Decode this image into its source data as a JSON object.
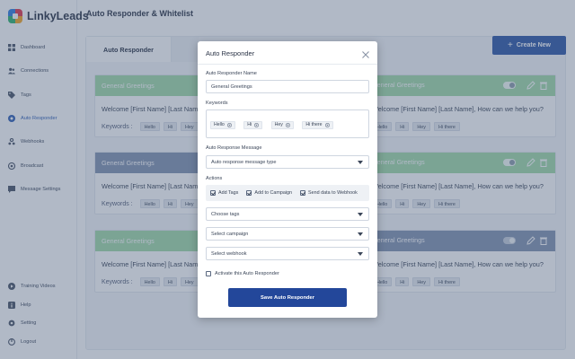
{
  "app": {
    "name": "LinkyLeads"
  },
  "sidebar": {
    "items": [
      {
        "label": "Dashboard",
        "icon": "dashboard-icon"
      },
      {
        "label": "Connections",
        "icon": "users-icon"
      },
      {
        "label": "Tags",
        "icon": "tag-icon"
      },
      {
        "label": "Auto Responder",
        "icon": "responder-icon",
        "active": true
      },
      {
        "label": "Webhooks",
        "icon": "webhook-icon"
      },
      {
        "label": "Broadcast",
        "icon": "broadcast-icon"
      },
      {
        "label": "Message Settings",
        "icon": "message-icon"
      }
    ],
    "bottom_items": [
      {
        "label": "Training Videos",
        "icon": "play-icon"
      },
      {
        "label": "Help",
        "icon": "help-icon"
      },
      {
        "label": "Setting",
        "icon": "gear-icon"
      },
      {
        "label": "Logout",
        "icon": "logout-icon"
      }
    ]
  },
  "header": {
    "title": "Auto Responder & Whitelist"
  },
  "main": {
    "tab_active": "Auto Responder",
    "create_button": "Create New",
    "cards": [
      {
        "left_title": "General Greetings",
        "right_title": "General Greetings",
        "color": "green",
        "toggle_on": true,
        "left_message": "Welcome [First Name] [Last Name],",
        "right_message": "Welcome [First Name] [Last Name], How can we help you?",
        "keywords_label": "Keywords :",
        "keywords": [
          "Hello",
          "Hi",
          "Hey",
          "Hi there"
        ]
      },
      {
        "left_title": "General Greetings",
        "right_title": "General Greetings",
        "color": "navy-left-green-right",
        "toggle_on": true,
        "left_message": "Welcome [First Name] [Last Name],",
        "right_message": "Welcome [First Name] [Last Name], How can we help you?",
        "keywords_label": "Keywords :",
        "keywords": [
          "Hello",
          "Hi",
          "Hey",
          "Hi there"
        ]
      },
      {
        "left_title": "General Greetings",
        "right_title": "General Greetings",
        "color": "green-left-navy-right",
        "toggle_on": false,
        "left_message": "Welcome [First Name] [Last Name],",
        "right_message": "Welcome [First Name] [Last Name], How can we help you?",
        "keywords_label": "Keywords :",
        "keywords": [
          "Hello",
          "Hi",
          "Hey",
          "Hi there"
        ]
      }
    ]
  },
  "modal": {
    "title": "Auto Responder",
    "name_label": "Auto Responder Name",
    "name_value": "General Greetings",
    "keywords_label": "Keywords",
    "keywords": [
      "Hello",
      "Hi",
      "Hey",
      "Hi there"
    ],
    "message_label": "Auto Response Message",
    "message_type_value": "Auto response message type",
    "actions_label": "Actions",
    "actions": [
      "Add Tags",
      "Add to Campaign",
      "Send data to Webhook"
    ],
    "choose_tags": "Choose tags",
    "select_campaign": "Select campaign",
    "select_webhook": "Select webhook",
    "activate_label": "Activate this Auto Responder",
    "save_label": "Save Auto Responder"
  },
  "colors": {
    "accent": "#2f58a8",
    "save": "#23479a",
    "green_header": "#a2dba9",
    "navy_header": "#8394b2"
  }
}
